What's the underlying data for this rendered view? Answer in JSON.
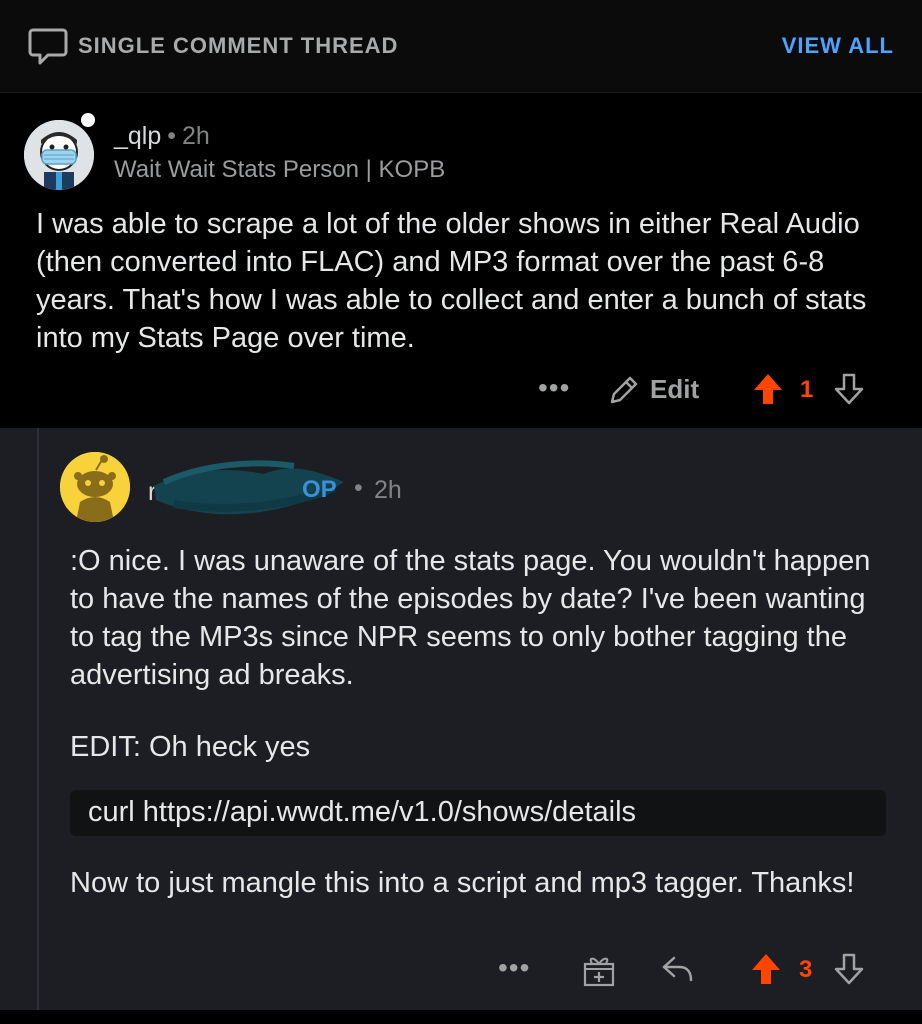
{
  "header": {
    "title": "SINGLE COMMENT THREAD",
    "view_all": "VIEW ALL",
    "icon": "comment-bubble-icon"
  },
  "comment": {
    "username": "_qlp",
    "separator": "•",
    "time": "2h",
    "flair": "Wait Wait Stats Person | KOPB",
    "body": "I was able to scrape a lot of the older shows in either Real Audio (then converted into FLAC) and MP3 format over the past 6-8 years. That's how I was able to collect and enter a bunch of stats into my Stats Page over time.",
    "more": "•••",
    "edit_label": "Edit",
    "score": "1",
    "upvote_color": "#ff4500"
  },
  "reply": {
    "op_label": "OP",
    "separator": "•",
    "time": "2h",
    "body_paragraph_1": ":O nice. I was unaware of the stats page. You wouldn't happen to have the names of the episodes by date? I've been wanting to tag the MP3s since NPR seems to only bother tagging the advertising ad breaks.",
    "body_paragraph_2": "EDIT: Oh heck yes",
    "code": "curl https://api.wwdt.me/v1.0/shows/details",
    "body_paragraph_3": "Now to just mangle this into a script and mp3 tagger. Thanks!",
    "more": "•••",
    "score": "3",
    "upvote_color": "#ff4500"
  }
}
